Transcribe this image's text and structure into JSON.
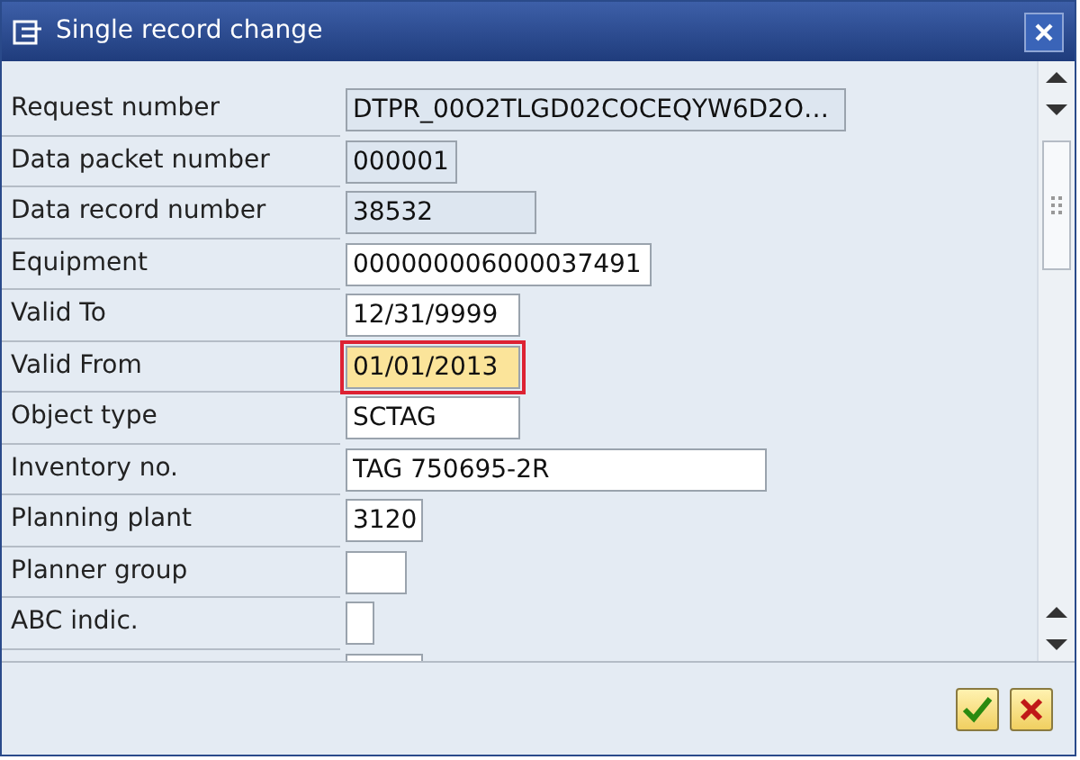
{
  "window": {
    "title": "Single record change"
  },
  "fields": [
    {
      "label": "Request number",
      "value": "DTPR_00O2TLGD02COCEQYW6D2O…",
      "readonly": true,
      "focused": false
    },
    {
      "label": "Data packet number",
      "value": "000001",
      "readonly": true,
      "focused": false
    },
    {
      "label": "Data record number",
      "value": "38532",
      "readonly": true,
      "focused": false
    },
    {
      "label": "Equipment",
      "value": "000000006000037491",
      "readonly": false,
      "focused": false
    },
    {
      "label": "Valid To",
      "value": "12/31/9999",
      "readonly": false,
      "focused": false
    },
    {
      "label": "Valid From",
      "value": "01/01/2013",
      "readonly": false,
      "focused": true
    },
    {
      "label": "Object type",
      "value": "SCTAG",
      "readonly": false,
      "focused": false
    },
    {
      "label": "Inventory no.",
      "value": "TAG 750695-2R",
      "readonly": false,
      "focused": false
    },
    {
      "label": "Planning plant",
      "value": "3120",
      "readonly": false,
      "focused": false
    },
    {
      "label": "Planner group",
      "readonly": false,
      "focused": false
    },
    {
      "label": "ABC indic.",
      "readonly": false,
      "focused": false
    }
  ]
}
